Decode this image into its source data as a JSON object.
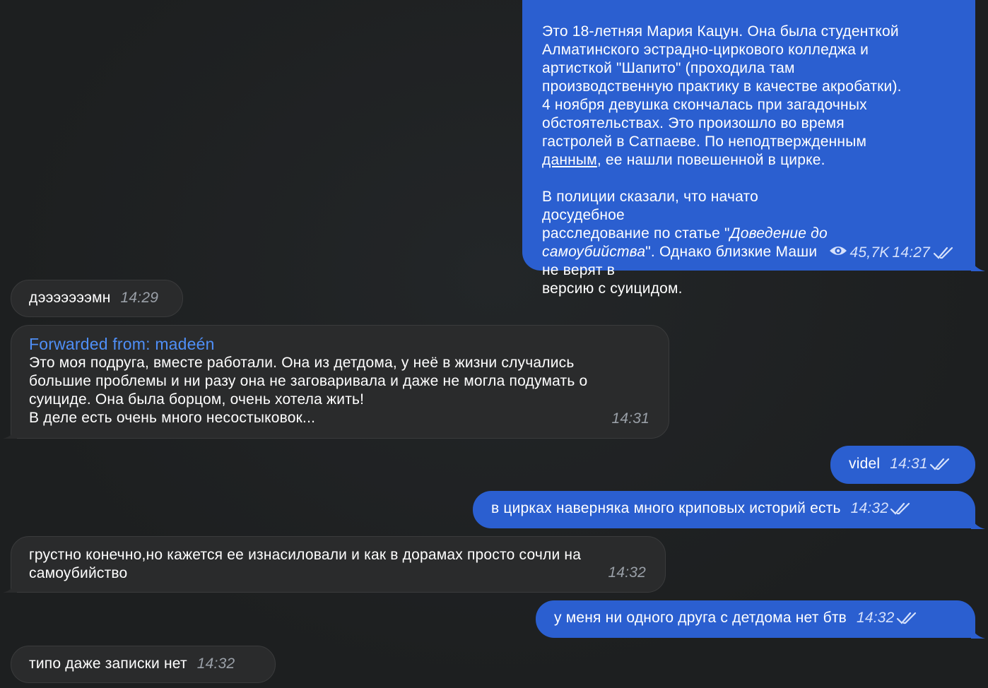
{
  "messages": {
    "m1": {
      "p1a": "Это 18-летняя Мария Кацун. Она была студенткой\nАлматинского эстрадно-циркового колледжа и\nартисткой \"Шапито\" (проходила там\nпроизводственную практику в качестве акробатки).\n4 ноября девушка скончалась при загадочных\nобстоятельствах. Это произошло во время\nгастролей в Сатпаеве. По неподтвержденным\n",
      "p1link": "данным",
      "p1b": ", ее нашли повешенной в цирке.",
      "p2a": "В полиции сказали, что начато досудебное\nрасследование по статье \"",
      "p2italic": "Доведение до\nсамоубийства",
      "p2b": "\". Однако близкие Маши не верят в\nверсию с суицидом.",
      "views": "45,7K",
      "time": "14:27"
    },
    "m2": {
      "text": "дэээээээмн",
      "time": "14:29"
    },
    "m3": {
      "fwd_label": "Forwarded from: ",
      "fwd_name": "madeén",
      "text": "Это моя подруга, вместе работали. Она из детдома, у неё в жизни случались\nбольшие проблемы и ни разу она не заговаривала и даже не могла подумать о\nсуициде. Она была борцом, очень хотела жить!\nВ деле есть очень много несостыковок...",
      "time": "14:31"
    },
    "m4": {
      "text": "videl",
      "time": "14:31"
    },
    "m5": {
      "text": "в цирках наверняка много криповых историй есть",
      "time": "14:32"
    },
    "m6": {
      "text": "грустно конечно,но кажется ее изнасиловали и как в дорамах просто сочли на\nсамоубийство",
      "time": "14:32"
    },
    "m7": {
      "text": "у меня ни одного друга с детдома нет бтв",
      "time": "14:32"
    },
    "m8": {
      "text": "типо даже записки нет",
      "time": "14:32"
    }
  },
  "colors": {
    "background": "#1e2021",
    "incoming_bubble": "#2a2b2c",
    "outgoing_bubble": "#2b5fd0",
    "forward_name": "#4f8ff7"
  },
  "icons": {
    "views": "eye-icon",
    "read": "double-check-icon"
  }
}
